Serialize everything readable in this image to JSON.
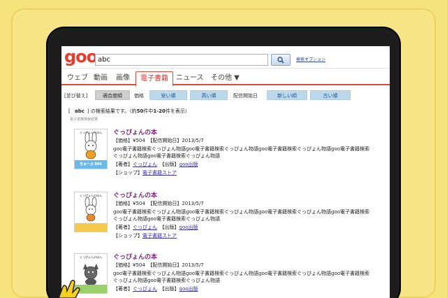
{
  "header": {
    "logo": "goo",
    "query": "abc",
    "search_option": "検索オプション"
  },
  "tabs": [
    {
      "label": "ウェブ",
      "active": false
    },
    {
      "label": "動画",
      "active": false
    },
    {
      "label": "画像",
      "active": false
    },
    {
      "label": "電子書籍",
      "active": true
    },
    {
      "label": "ニュース",
      "active": false
    },
    {
      "label": "その他 ▼",
      "active": false
    }
  ],
  "filter": {
    "sort_label": "[並び替え]",
    "relevance": "適合度順",
    "price_label": "価格",
    "price_low": "安い順",
    "price_high": "高い順",
    "date_label": "配信開始日",
    "date_new": "新しい順",
    "date_old": "古い順"
  },
  "results": {
    "open": "[",
    "query": "abc",
    "text": "] の検索結果です。（約",
    "total": "50",
    "text2": "件中",
    "range": "1-20",
    "text3": "件を表示）",
    "category": "電子書籍検索結果"
  },
  "items": [
    {
      "title": "ぐっぴょんの本",
      "meta": "【価格】¥504　【配信開始日】2013/5/7",
      "desc1": "goo電子書籍検索ぐっぴょん物語goo電子書籍検索ぐっぴょん物語goo電子書籍検索ぐっぴょん物語goo電子書籍検索",
      "desc2": "ぐっぴょん物語goo電子書籍検索ぐっぴょん物語",
      "author_label": "【著者】",
      "author": "ぐっぴょん",
      "pub_label": "【出版】",
      "publisher": "goo出版",
      "shop_label": "【ショップ】",
      "shop": "電子書籍ストア",
      "thumb_title": "ぐっぴょんのほん",
      "thumb_badge": "きゅーぷ 800"
    },
    {
      "title": "ぐっぴょんの本",
      "meta": "【価格】¥504　【配信開始日】2013/5/7",
      "desc1": "goo電子書籍検索ぐっぴょん物語goo電子書籍検索ぐっぴょん物語goo電子書籍検索ぐっぴょん物語goo電子書籍検索",
      "desc2": "ぐっぴょん物語goo電子書籍検索ぐっぴょん物語",
      "author_label": "【著者】",
      "author": "ぐっぴょん",
      "pub_label": "【出版】",
      "publisher": "goo出版",
      "shop_label": "【ショップ】",
      "shop": "電子書籍ストア",
      "thumb_title": "ぐっぴょんのほん"
    },
    {
      "title": "ぐっぴょんの本",
      "meta": "【価格】¥504　【配信開始日】2013/5/7",
      "desc1": "goo電子書籍検索ぐっぴょん物語goo電子書籍検索ぐっぴょん物語goo電子書籍検索ぐっぴょん物語goo電子書籍検索",
      "desc2": "ぐっぴょん物語goo電子書籍検索ぐっぴょん物語",
      "author_label": "【著者】",
      "author": "ぐっぴょん",
      "pub_label": "【出版】",
      "publisher": "goo出版",
      "thumb_title": "ぐっぴょんのほん"
    }
  ],
  "colors": {
    "background": "#f4e27a",
    "accent": "#e14a3b",
    "title": "#7a2a7a",
    "link": "#3a2fb0"
  }
}
